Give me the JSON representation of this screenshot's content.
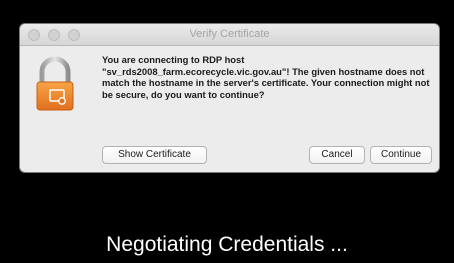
{
  "dialog": {
    "title": "Verify Certificate",
    "message": "You are connecting to RDP host \"sv_rds2008_farm.ecorecycle.vic.gov.au\"! The given hostname does not match the hostname in the server's certificate. Your connection might not be secure, do you want to continue?",
    "icon": "lock-certificate-icon",
    "buttons": {
      "show_certificate": "Show Certificate",
      "cancel": "Cancel",
      "continue": "Continue"
    }
  },
  "status": {
    "text": "Negotiating Credentials ..."
  },
  "colors": {
    "background": "#000000",
    "dialog_bg": "#ececec",
    "lock_orange": "#f0882a",
    "status_text": "#ffffff"
  }
}
